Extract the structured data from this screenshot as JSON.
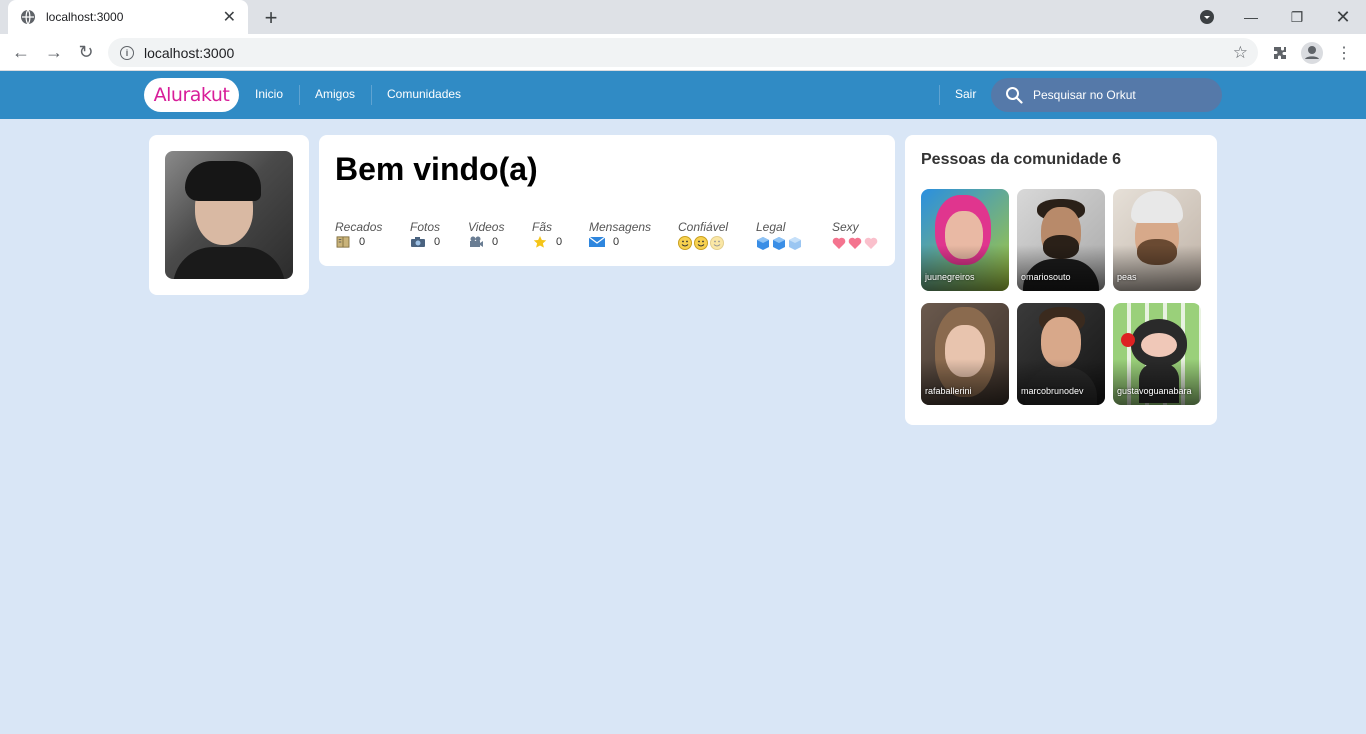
{
  "browser": {
    "tab_title": "localhost:3000",
    "url": "localhost:3000"
  },
  "header": {
    "logo": "Alurakut",
    "menu": [
      "Inicio",
      "Amigos",
      "Comunidades"
    ],
    "logout": "Sair",
    "search_placeholder": "Pesquisar no Orkut"
  },
  "welcome": {
    "title": "Bem vindo(a)",
    "stats": [
      {
        "label": "Recados",
        "value": "0",
        "icon": "book-icon"
      },
      {
        "label": "Fotos",
        "value": "0",
        "icon": "camera-icon"
      },
      {
        "label": "Videos",
        "value": "0",
        "icon": "video-camera-icon"
      },
      {
        "label": "Fãs",
        "value": "0",
        "icon": "star-icon"
      },
      {
        "label": "Mensagens",
        "value": "0",
        "icon": "envelope-icon"
      }
    ],
    "ratings": [
      {
        "label": "Confiável",
        "icon": "smiley-icon"
      },
      {
        "label": "Legal",
        "icon": "ice-cube-icon"
      },
      {
        "label": "Sexy",
        "icon": "heart-icon"
      }
    ]
  },
  "community": {
    "title": "Pessoas da comunidade 6",
    "people": [
      "juunegreiros",
      "omariosouto",
      "peas",
      "rafaballerini",
      "marcobrunodev",
      "gustavoguanabara"
    ]
  },
  "colors": {
    "header_bg": "#308BC5",
    "page_bg": "#D9E6F6",
    "logo": "#D81D99",
    "search_bg": "#5579A9"
  }
}
